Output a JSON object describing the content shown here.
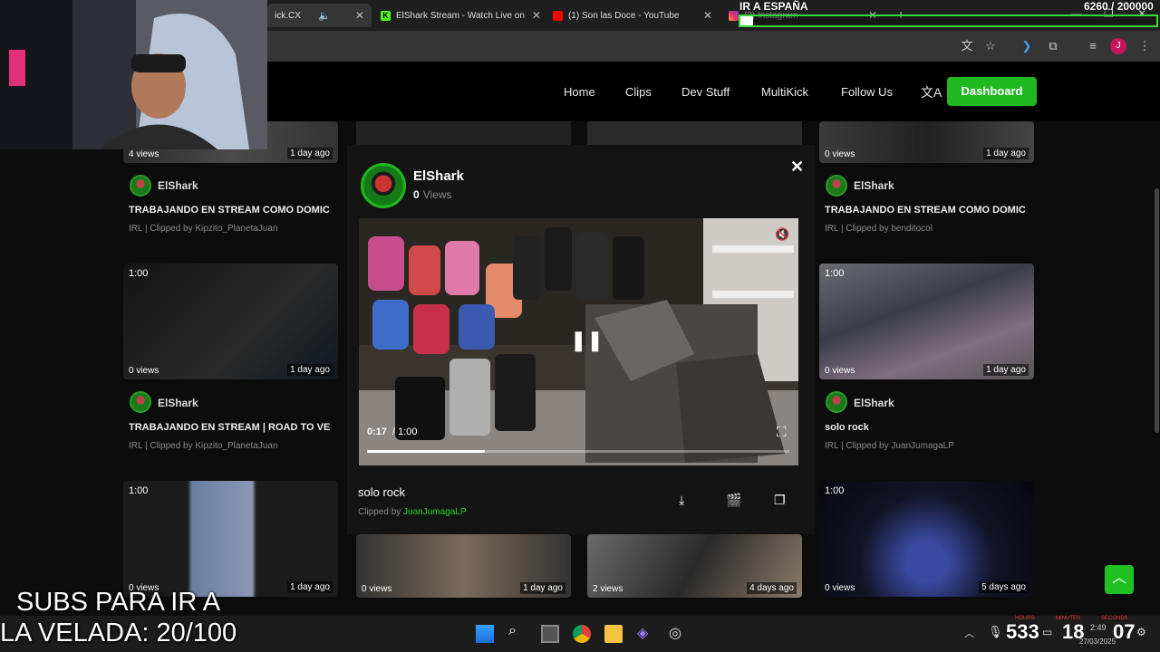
{
  "browser": {
    "tabs": [
      {
        "label": "ick.CX",
        "favicon": "#ddd",
        "active": true
      },
      {
        "label": "ElShark Stream - Watch Live on",
        "favicon": "#53fc18"
      },
      {
        "label": "(1) Son las Doce - YouTube",
        "favicon": "#ff0000"
      },
      {
        "label": "(2) Instagram",
        "favicon": "#e1306c"
      }
    ]
  },
  "site": {
    "nav": [
      "Home",
      "Clips",
      "Dev Stuff",
      "MultiKick",
      "Follow Us"
    ],
    "dashboard_label": "Dashboard",
    "accent": "#1fb91f",
    "cards": [
      {
        "duration": "",
        "views": "4 views",
        "ago": "1 day ago",
        "name": "ElShark",
        "title": "TRABAJANDO EN STREAM COMO DOMIC",
        "meta": "IRL | Clipped by Kipzito_PlanetaJuan"
      },
      {
        "duration": "",
        "views": "0 views",
        "ago": "1 day ago",
        "name": "ElShark",
        "title": "TRABAJANDO EN STREAM COMO DOMIC",
        "meta": "IRL | Clipped by benditocol"
      },
      {
        "duration": "1:00",
        "views": "0 views",
        "ago": "1 day ago",
        "name": "ElShark",
        "title": "TRABAJANDO EN STREAM | ROAD TO VE",
        "meta": "IRL | Clipped by Kipzito_PlanetaJuan"
      },
      {
        "duration": "1:00",
        "views": "0 views",
        "ago": "1 day ago",
        "name": "ElShark",
        "title": "solo rock",
        "meta": "IRL | Clipped by JuanJumagaLP"
      },
      {
        "duration": "1:00",
        "views": "0 views",
        "ago": "1 day ago"
      },
      {
        "duration": "",
        "views": "0 views",
        "ago": "1 day ago"
      },
      {
        "duration": "",
        "views": "2 views",
        "ago": "4 days ago"
      },
      {
        "duration": "1:00",
        "views": "0 views",
        "ago": "5 days ago"
      }
    ]
  },
  "modal": {
    "channel": "ElShark",
    "views_count": "0",
    "views_label": "Views",
    "time_current": "0:17",
    "time_total": "/ 1:00",
    "progress": 0.28,
    "clip_title": "solo rock",
    "clipped_by_label": "Clipped by",
    "clipped_by_user": "JuanJumagaLP"
  },
  "overlay": {
    "goal_label": "IR A ESPAÑA",
    "goal_value": "6260 / 200000",
    "goal_progress": 0.031,
    "subs_text_1": "SUBS PARA IR A",
    "subs_text_2": "LA VELADA: 20/100"
  },
  "taskbar": {
    "clock_time": "2:49",
    "clock_date": "27/03/2025",
    "counter": "533",
    "timer_h": "18",
    "timer_m": "07",
    "timer_labels": [
      "HOURS",
      "MINUTES",
      "SECONDS"
    ]
  }
}
